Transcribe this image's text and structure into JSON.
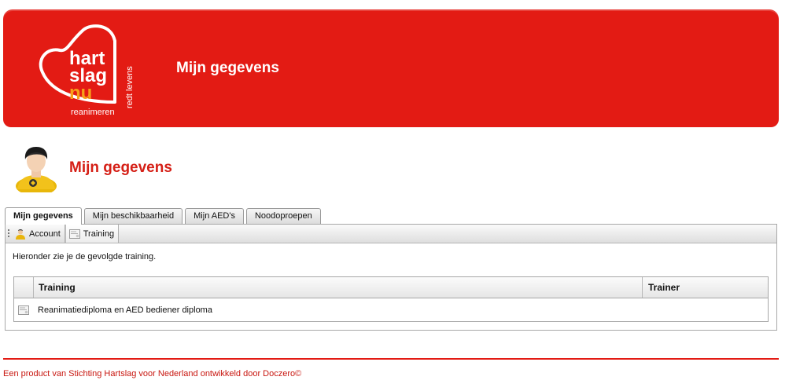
{
  "header": {
    "title": "Mijn gegevens",
    "logo": {
      "line1": "hart",
      "line2": "slag",
      "line3": "nu",
      "tagline": "reanimeren",
      "vertical_text": "redt levens"
    }
  },
  "page": {
    "title": "Mijn gegevens",
    "avatar_icon": "user-avatar-icon"
  },
  "tabs": [
    {
      "label": "Mijn gegevens",
      "active": true
    },
    {
      "label": "Mijn beschikbaarheid",
      "active": false
    },
    {
      "label": "Mijn AED's",
      "active": false
    },
    {
      "label": "Noodoproepen",
      "active": false
    }
  ],
  "subtabs": [
    {
      "label": "Account",
      "icon": "user-icon"
    },
    {
      "label": "Training",
      "icon": "certificate-icon",
      "active": true
    }
  ],
  "content": {
    "intro": "Hieronder zie je de gevolgde training."
  },
  "table": {
    "columns": [
      "Training",
      "Trainer"
    ],
    "rows": [
      {
        "training": "Reanimatiediploma en AED bediener diploma",
        "trainer": "",
        "icon": "certificate-icon"
      }
    ]
  },
  "footer": {
    "text": "Een product van Stichting Hartslag voor Nederland ontwikkeld door Doczero©"
  },
  "colors": {
    "brand_red": "#e31b14",
    "title_red": "#d51f16",
    "logo_orange": "#f6a01a"
  }
}
